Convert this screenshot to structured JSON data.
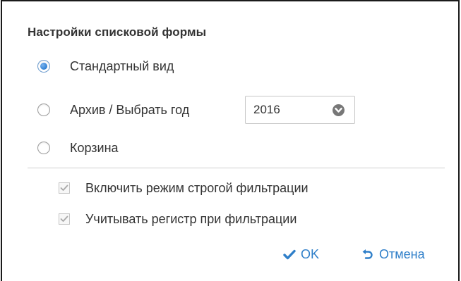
{
  "dialog": {
    "title": "Настройки списковой формы",
    "view_options": [
      {
        "label": "Стандартный вид",
        "checked": true
      },
      {
        "label": "Архив / Выбрать год",
        "checked": false
      },
      {
        "label": "Корзина",
        "checked": false
      }
    ],
    "year_select": {
      "value": "2016"
    },
    "checkboxes": [
      {
        "label": "Включить режим строгой фильтрации",
        "checked": true,
        "disabled": true
      },
      {
        "label": "Учитывать регистр при фильтрации",
        "checked": true,
        "disabled": true
      }
    ],
    "ok_label": "OK",
    "cancel_label": "Отмена"
  },
  "colors": {
    "accent": "#2f7fc9",
    "radio_dot": "#2e7fd3",
    "text": "#333333",
    "divider": "#cfcfcf"
  }
}
